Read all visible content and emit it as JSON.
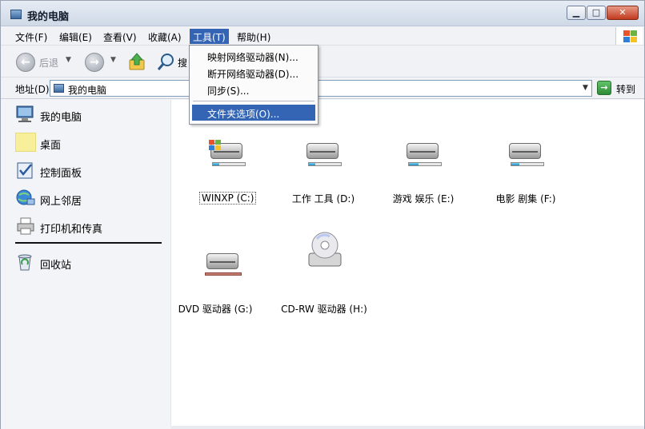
{
  "window": {
    "title": "我的电脑"
  },
  "window_buttons": {
    "minimize": "▁",
    "maximize": "□",
    "close": "✕"
  },
  "menubar": {
    "items": [
      {
        "label": "文件(F)"
      },
      {
        "label": "编辑(E)"
      },
      {
        "label": "查看(V)"
      },
      {
        "label": "收藏(A)"
      },
      {
        "label": "工具(T)",
        "active": true
      },
      {
        "label": "帮助(H)"
      }
    ]
  },
  "toolbar": {
    "back_label": "后退",
    "back_glyph": "←",
    "forward_glyph": "→",
    "search_label": "搜",
    "dropdown_glyph": "▼"
  },
  "address": {
    "label": "地址(D)",
    "value": "我的电脑",
    "dropdown_glyph": "▼",
    "go_label": "转到",
    "go_glyph": "→"
  },
  "tools_menu": {
    "items": [
      {
        "label": "映射网络驱动器(N)..."
      },
      {
        "label": "断开网络驱动器(D)..."
      },
      {
        "label": "同步(S)..."
      },
      {
        "label": "文件夹选项(O)...",
        "highlighted": true
      }
    ]
  },
  "sidebar": {
    "items": [
      {
        "label": "我的电脑",
        "icon": "computer-icon"
      },
      {
        "label": "桌面",
        "icon": "desktop-icon"
      },
      {
        "label": "控制面板",
        "icon": "control-panel-icon"
      },
      {
        "label": "网上邻居",
        "icon": "network-icon"
      },
      {
        "label": "打印机和传真",
        "icon": "printer-icon"
      },
      {
        "label": "回收站",
        "icon": "recycle-bin-icon"
      }
    ]
  },
  "drives": [
    {
      "label": "WINXP (C:)",
      "icon": "system-drive-icon",
      "used": 0.2,
      "selected": true
    },
    {
      "label": "工作 工具 (D:)",
      "icon": "hard-drive-icon",
      "used": 0.2
    },
    {
      "label": "游戏 娱乐 (E:)",
      "icon": "hard-drive-icon",
      "used": 0.3
    },
    {
      "label": "电影 剧集 (F:)",
      "icon": "hard-drive-icon",
      "used": 0.25
    },
    {
      "label": "DVD 驱动器 (G:)",
      "icon": "dvd-drive-icon"
    },
    {
      "label": "CD-RW 驱动器 (H:)",
      "icon": "cd-drive-icon"
    }
  ],
  "colors": {
    "menu_highlight": "#3465b5",
    "drive_usage": "#1d8fc5"
  }
}
